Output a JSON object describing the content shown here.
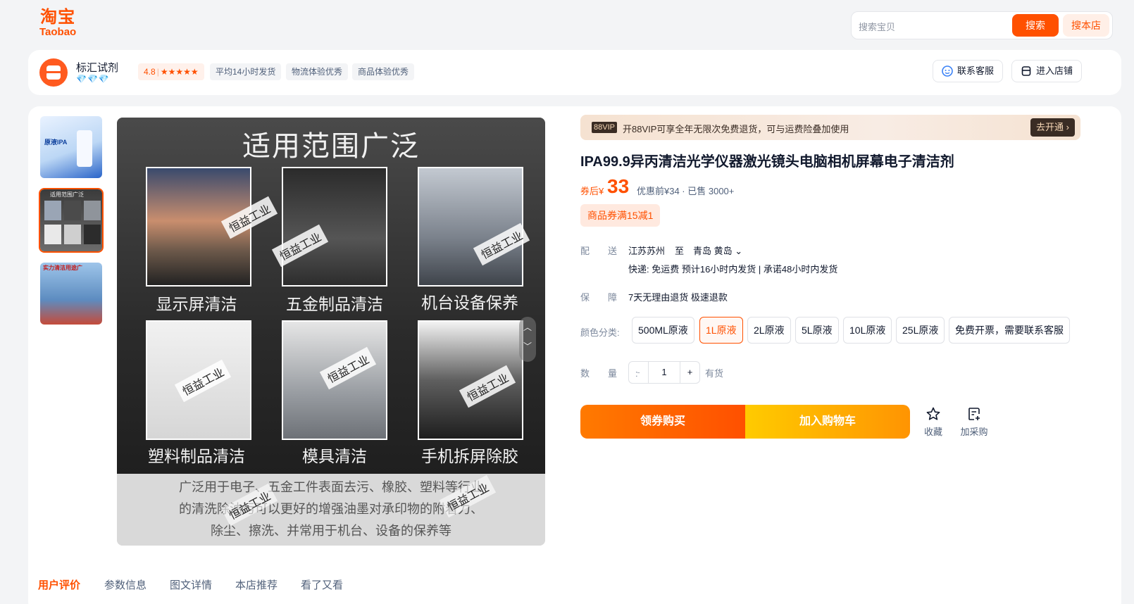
{
  "header": {
    "logo_cn": "淘宝",
    "logo_en": "Taobao",
    "search_placeholder": "搜索宝贝",
    "search_button": "搜索",
    "search_shop_button": "搜本店"
  },
  "shop": {
    "name": "标汇试剂",
    "diamonds": "💎💎💎",
    "rating": "4.8",
    "stars": "★★★★★",
    "tags": [
      "平均14小时发货",
      "物流体验优秀",
      "商品体验优秀"
    ],
    "contact_button": "联系客服",
    "enter_button": "进入店铺"
  },
  "gallery": {
    "title": "适用范围广泛",
    "tiles": [
      "显示屏清洁",
      "五金制品清洁",
      "机台设备保养",
      "塑料制品清洁",
      "模具清洁",
      "手机拆屏除胶"
    ],
    "watermark": "恒益工业",
    "caption_lines": [
      "广泛用于电子、五金工件表面去污、橡胶、塑料等行业",
      "的清洗除油污可以更好的增强油墨对承印物的附着力、",
      "除尘、擦洗、并常用于机台、设备的保养等"
    ],
    "thumbs": [
      {
        "caption": "原液IPA"
      },
      {
        "caption": "适用范围广泛"
      },
      {
        "caption": "实力清洁用途广"
      }
    ]
  },
  "vip": {
    "badge": "88VIP",
    "text": "开88VIP可享全年无限次免费退货，可与运费险叠加使用",
    "go": "去开通 ›"
  },
  "product": {
    "title": "IPA99.9异丙清洁光学仪器激光镜头电脑相机屏幕电子清洁剂",
    "price_label": "券后¥",
    "price": "33",
    "price_sub": "优惠前¥34 · 已售 3000+",
    "coupon": "商品券满15减1"
  },
  "delivery": {
    "label": "配送:",
    "from": "江苏苏州",
    "to_word": "至",
    "to": "青岛 黄岛 ⌄",
    "detail": "快递: 免运费   预计16小时内发货 | 承诺48小时内发货"
  },
  "guarantee": {
    "label": "保障:",
    "text": "7天无理由退货 极速退款"
  },
  "options": {
    "label": "颜色分类:",
    "items": [
      "500ML原液",
      "1L原液",
      "2L原液",
      "5L原液",
      "10L原液",
      "25L原液",
      "免费开票，需要联系客服"
    ],
    "selected_index": 1
  },
  "quantity": {
    "label": "数量:",
    "minus": "-",
    "value": "1",
    "plus": "+",
    "stock": "有货"
  },
  "actions": {
    "buy": "领券购买",
    "cart": "加入购物车",
    "favorite": "收藏",
    "purchase": "加采购"
  },
  "tabs": [
    "用户评价",
    "参数信息",
    "图文详情",
    "本店推荐",
    "看了又看"
  ],
  "colors": {
    "accent": "#ff5000",
    "accent_light": "#ffefe7"
  }
}
